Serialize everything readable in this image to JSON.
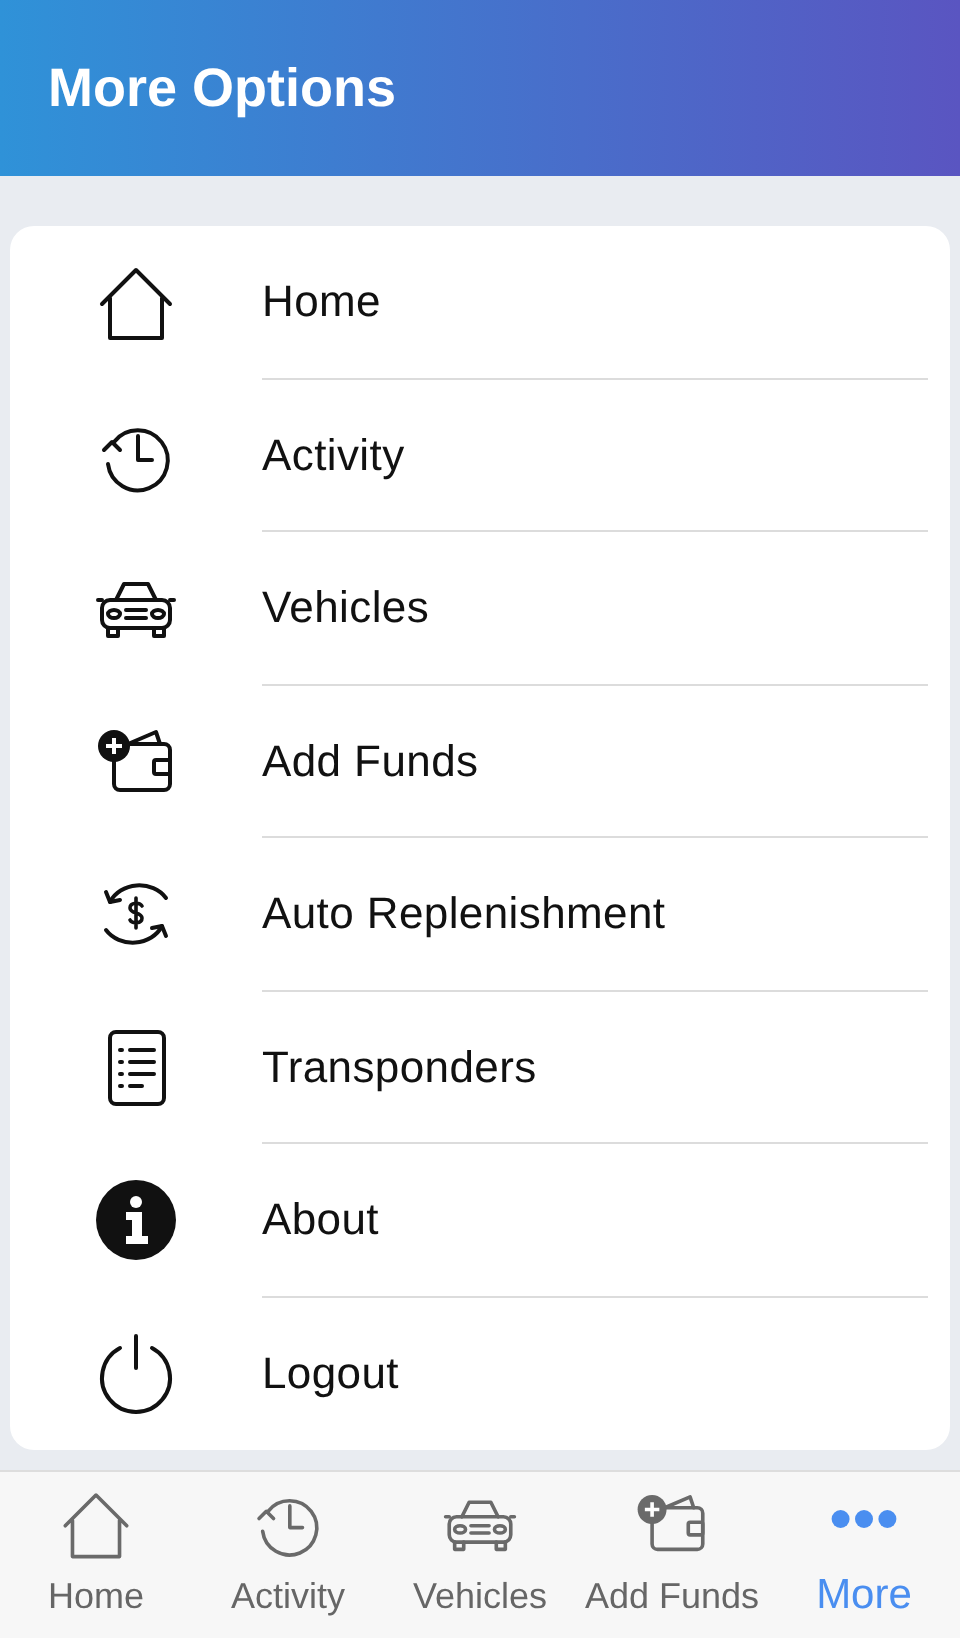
{
  "header": {
    "title": "More Options"
  },
  "menu": [
    {
      "label": "Home",
      "kind": "home"
    },
    {
      "label": "Activity",
      "kind": "clock"
    },
    {
      "label": "Vehicles",
      "kind": "car"
    },
    {
      "label": "Add Funds",
      "kind": "wallet"
    },
    {
      "label": "Auto Replenishment",
      "kind": "exchange"
    },
    {
      "label": "Transponders",
      "kind": "list"
    },
    {
      "label": "About",
      "kind": "info"
    },
    {
      "label": "Logout",
      "kind": "power"
    }
  ],
  "bottom_nav": [
    {
      "label": "Home",
      "kind": "home",
      "selected": false
    },
    {
      "label": "Activity",
      "kind": "clock",
      "selected": false
    },
    {
      "label": "Vehicles",
      "kind": "car",
      "selected": false
    },
    {
      "label": "Add Funds",
      "kind": "wallet",
      "selected": false
    },
    {
      "label": "More",
      "kind": "dots",
      "selected": true
    }
  ]
}
